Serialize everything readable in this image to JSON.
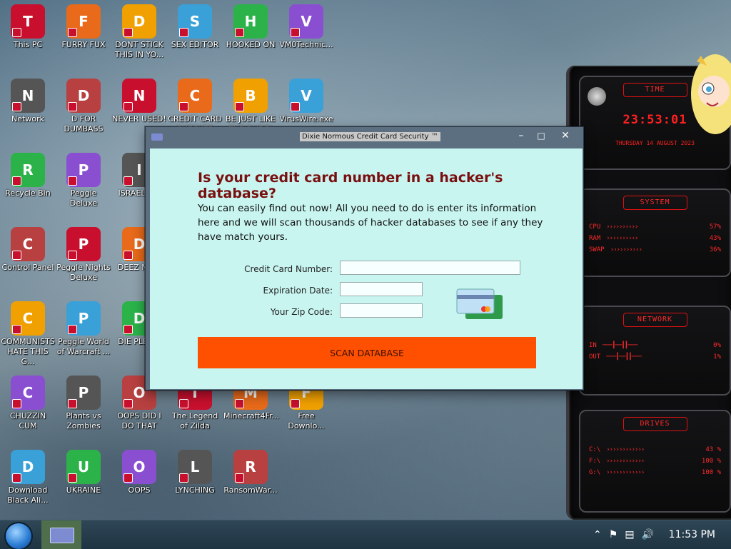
{
  "desktop": {
    "icons": [
      {
        "label": "This PC",
        "icon": "monitor-icon"
      },
      {
        "label": "FURRY FUX",
        "icon": "firefox-icon"
      },
      {
        "label": "DONT STICK THIS IN YO...",
        "icon": "vlc-cone-icon"
      },
      {
        "label": "SEX EDITOR",
        "icon": "hxd-icon"
      },
      {
        "label": "HOOKED ON",
        "icon": "maze-icon"
      },
      {
        "label": "VM0Technic...",
        "icon": "doctor-icon"
      },
      {
        "label": "Network",
        "icon": "network-orb-icon"
      },
      {
        "label": "D FOR DUMBASS",
        "icon": "spotify-icon"
      },
      {
        "label": "NEVER USED!",
        "icon": "devcpp-icon"
      },
      {
        "label": "CREDIT CARD CHECKER",
        "icon": "credit-card-icon"
      },
      {
        "label": "BE JUST LIKE THE DUDE!",
        "icon": "gnome-icon"
      },
      {
        "label": "VirusWire.exe",
        "icon": "lime-icon"
      },
      {
        "label": "Recycle Bin",
        "icon": "recycle-bin-icon"
      },
      {
        "label": "Peggle Deluxe",
        "icon": "peggle-icon"
      },
      {
        "label": "ISRAEL S...",
        "icon": "network-share-icon"
      },
      {
        "label": "Control Panel",
        "icon": "control-panel-icon"
      },
      {
        "label": "Peggle Nights Deluxe",
        "icon": "peggle-nights-icon"
      },
      {
        "label": "DEEZ NU...",
        "icon": "windows-stack-icon"
      },
      {
        "label": "COMMUNISTS HATE THIS G...",
        "icon": "money-bag-icon"
      },
      {
        "label": "Peggle World of Warcraft ...",
        "icon": "peggle-wow-icon"
      },
      {
        "label": "DIE PLEA...",
        "icon": "die-icon"
      },
      {
        "label": "CHUZZIN CUM",
        "icon": "chuzzle-icon"
      },
      {
        "label": "Plants vs Zombies",
        "icon": "pvz-icon"
      },
      {
        "label": "OOPS DID I DO THAT",
        "icon": "portrait-icon"
      },
      {
        "label": "The Legend of Zilda",
        "icon": "zelda-icon"
      },
      {
        "label": "Minecraft4Fr...",
        "icon": "minecraft-icon"
      },
      {
        "label": "Free Downlo...",
        "icon": "download-arrow-icon"
      },
      {
        "label": "Download Black Ali...",
        "icon": "alienware-orb-icon"
      },
      {
        "label": "UKRAINE",
        "icon": "radiation-icon"
      },
      {
        "label": "OOPS",
        "icon": "dark-card-icon"
      },
      {
        "label": "LYNCHING",
        "icon": "noose-icon"
      },
      {
        "label": "RansomWar...",
        "icon": "skull-icon"
      }
    ]
  },
  "widget": {
    "time_head": "TIME",
    "time": "23:53:01",
    "date": "THURSDAY 14 AUGUST 2023",
    "system_head": "SYSTEM",
    "system_rows": [
      {
        "label": "CPU",
        "value": "57%"
      },
      {
        "label": "RAM",
        "value": "43%"
      },
      {
        "label": "SWAP",
        "value": "36%"
      }
    ],
    "network_head": "NETWORK",
    "network_rows": [
      {
        "label": "IN",
        "value": "0%"
      },
      {
        "label": "OUT",
        "value": "1%"
      }
    ],
    "drives_head": "DRIVES",
    "drive_rows": [
      {
        "label": "C:\\",
        "value": "43 %"
      },
      {
        "label": "F:\\",
        "value": "100 %"
      },
      {
        "label": "G:\\",
        "value": "100 %"
      }
    ]
  },
  "window": {
    "title": "Dixie Normous Credit Card Security ™",
    "controls": {
      "minimize": "–",
      "maximize": "□",
      "close": "✕"
    },
    "heading": "Is your credit card number in a hacker's database?",
    "description": "You can easily find out now! All you need to do is enter its information here and we will scan thousands of hacker databases to see if any they have match yours.",
    "fields": {
      "card_label": "Credit Card Number:",
      "card_value": "",
      "expiry_label": "Expiration Date:",
      "expiry_value": "",
      "zip_label": "Your Zip Code:",
      "zip_value": ""
    },
    "button_label": "SCAN DATABASE",
    "accent_color": "#ff4f00",
    "heading_color": "#7a0f0f",
    "content_bg": "#c8f5f0"
  },
  "taskbar": {
    "clock": "11:53 PM",
    "tray_icons": [
      "chevron-up-icon",
      "flag-icon",
      "network-icon",
      "speaker-icon"
    ]
  }
}
